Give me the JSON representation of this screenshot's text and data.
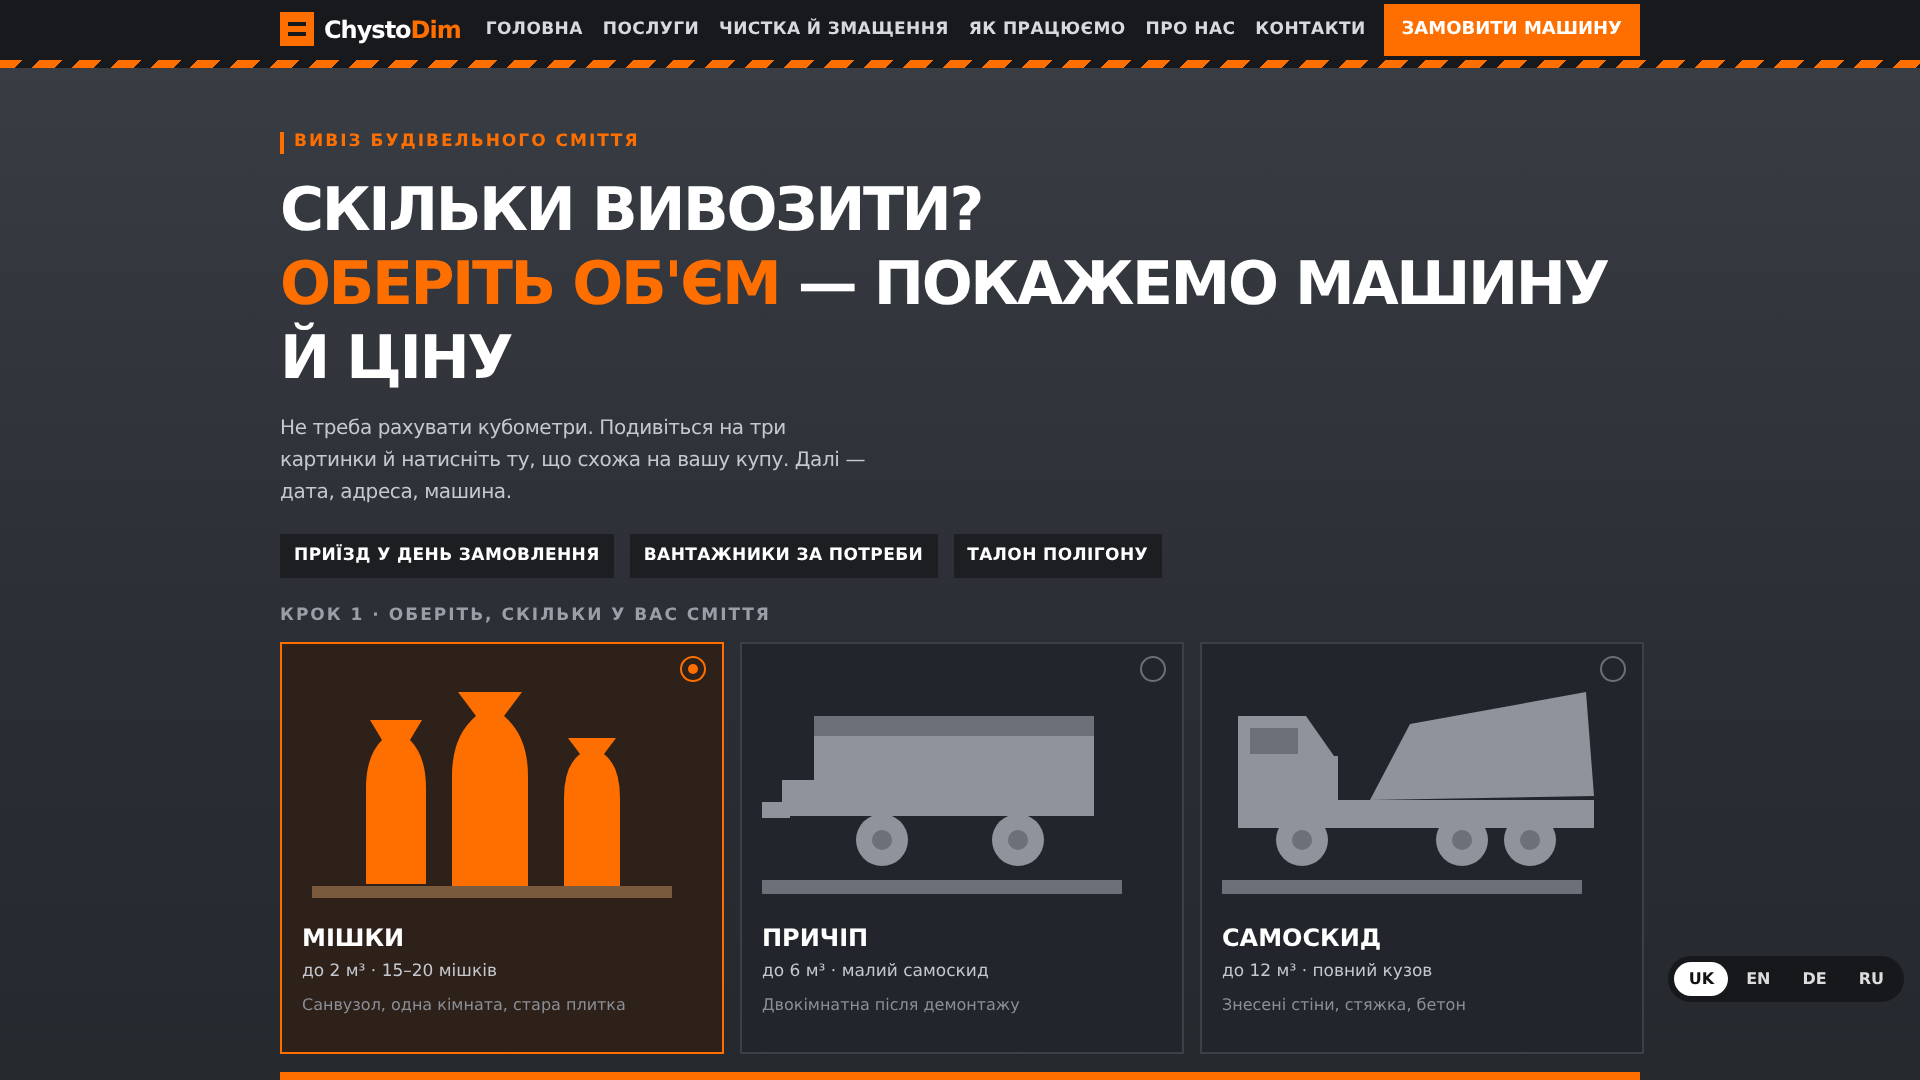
{
  "brand": {
    "name_part1": "Chysto",
    "name_part2": "Dim"
  },
  "nav": {
    "items": [
      "ГОЛОВНА",
      "ПОСЛУГИ",
      "ЧИСТКА Й ЗМАЩЕННЯ",
      "ЯК ПРАЦЮЄМО",
      "ПРО НАС",
      "КОНТАКТИ"
    ],
    "cta": "ЗАМОВИТИ МАШИНУ"
  },
  "hero": {
    "eyebrow": "ВИВІЗ БУДІВЕЛЬНОГО СМІТТЯ",
    "title_line1": "СКІЛЬКИ ВИВОЗИТИ?",
    "title_accent": "ОБЕРІТЬ ОБ'ЄМ",
    "title_rest": "— ПОКАЖЕМО МАШИНУ Й ЦІНУ",
    "lead": "Не треба рахувати кубометри. Подивіться на три картинки й натисніть ту, що схожа на вашу купу. Далі — дата, адреса, машина.",
    "tags": [
      "ПРИЇЗД У ДЕНЬ ЗАМОВЛЕННЯ",
      "ВАНТАЖНИКИ ЗА ПОТРЕБИ",
      "ТАЛОН ПОЛІГОНУ"
    ]
  },
  "step": {
    "label": "КРОК 1 · ОБЕРІТЬ, СКІЛЬКИ У ВАС СМІТТЯ",
    "cards": [
      {
        "kind": "bags",
        "title": "МІШКИ",
        "volume": "до 2 м³ · 15–20 мішків",
        "note": "Санвузол, одна кімната, стара плитка",
        "selected": true
      },
      {
        "kind": "trailer",
        "title": "ПРИЧІП",
        "volume": "до 6 м³ · малий самоскид",
        "note": "Двокімнатна після демонтажу",
        "selected": false
      },
      {
        "kind": "dump",
        "title": "САМОСКИД",
        "volume": "до 12 м³ · повний кузов",
        "note": "Знесені стіни, стяжка, бетон",
        "selected": false
      }
    ]
  },
  "languages": [
    {
      "code": "UK",
      "selected": true
    },
    {
      "code": "EN",
      "selected": false
    },
    {
      "code": "DE",
      "selected": false
    },
    {
      "code": "RU",
      "selected": false
    }
  ]
}
